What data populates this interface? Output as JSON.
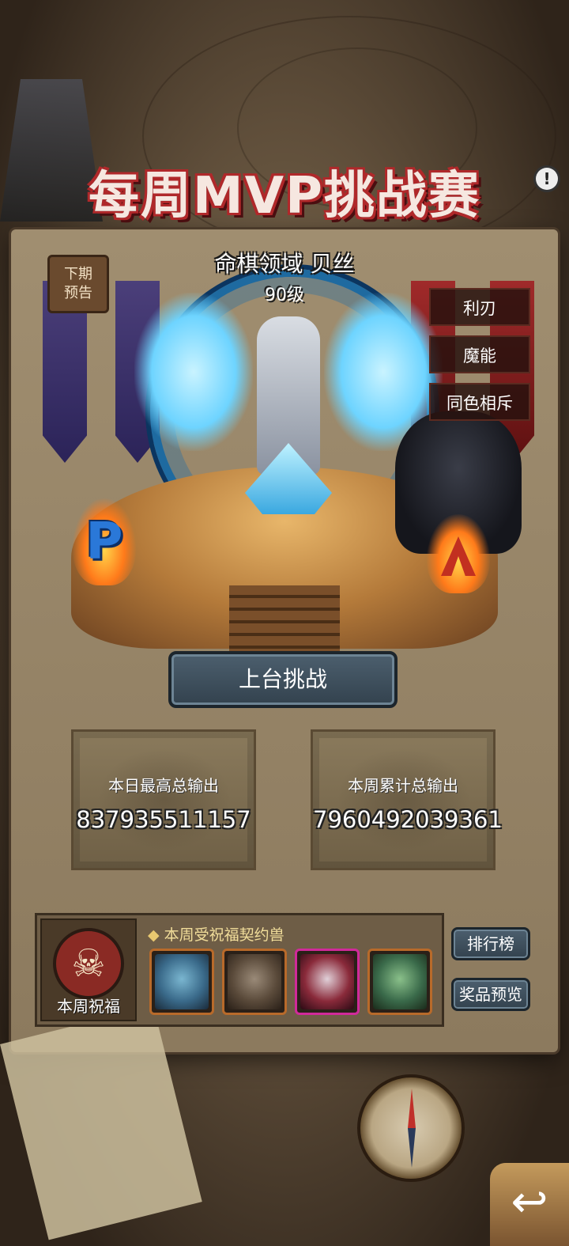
{
  "title": "每周MVP挑战赛",
  "info_icon_glyph": "!",
  "next_preview": {
    "line1": "下期",
    "line2": "预告"
  },
  "hero": {
    "name": "命棋领域 贝丝",
    "level": "90级"
  },
  "traits": [
    "利刃",
    "魔能",
    "同色相斥"
  ],
  "flag_p_letter": "P",
  "challenge_button": "上台挑战",
  "stats": [
    {
      "label": "本日最高总输出",
      "value": "837935511157"
    },
    {
      "label": "本周累计总输出",
      "value": "7960492039361"
    }
  ],
  "blessing": {
    "emblem_label": "本周祝福",
    "title": "本周受祝福契约兽",
    "skull_glyph": "☠",
    "pets": [
      {
        "icon": "pet-ghost-witch-icon",
        "color": "#3a6a8a",
        "rarity": "epic"
      },
      {
        "icon": "pet-beast-icon",
        "color": "#5a4a3a",
        "rarity": "epic"
      },
      {
        "icon": "pet-dragon-icon",
        "color": "#8a2a3a",
        "rarity": "legendary"
      },
      {
        "icon": "pet-plant-goblin-icon",
        "color": "#3a6a4a",
        "rarity": "epic"
      }
    ]
  },
  "side_buttons": {
    "ranking": "排行榜",
    "prize_preview": "奖品预览"
  },
  "return_glyph": "↩",
  "colors": {
    "title_outline": "#b0282a",
    "button_fill": "#3f5160",
    "panel": "#8c7a5e",
    "pet_border_epic": "#b86a2a",
    "pet_border_legendary": "#d02a9a"
  }
}
